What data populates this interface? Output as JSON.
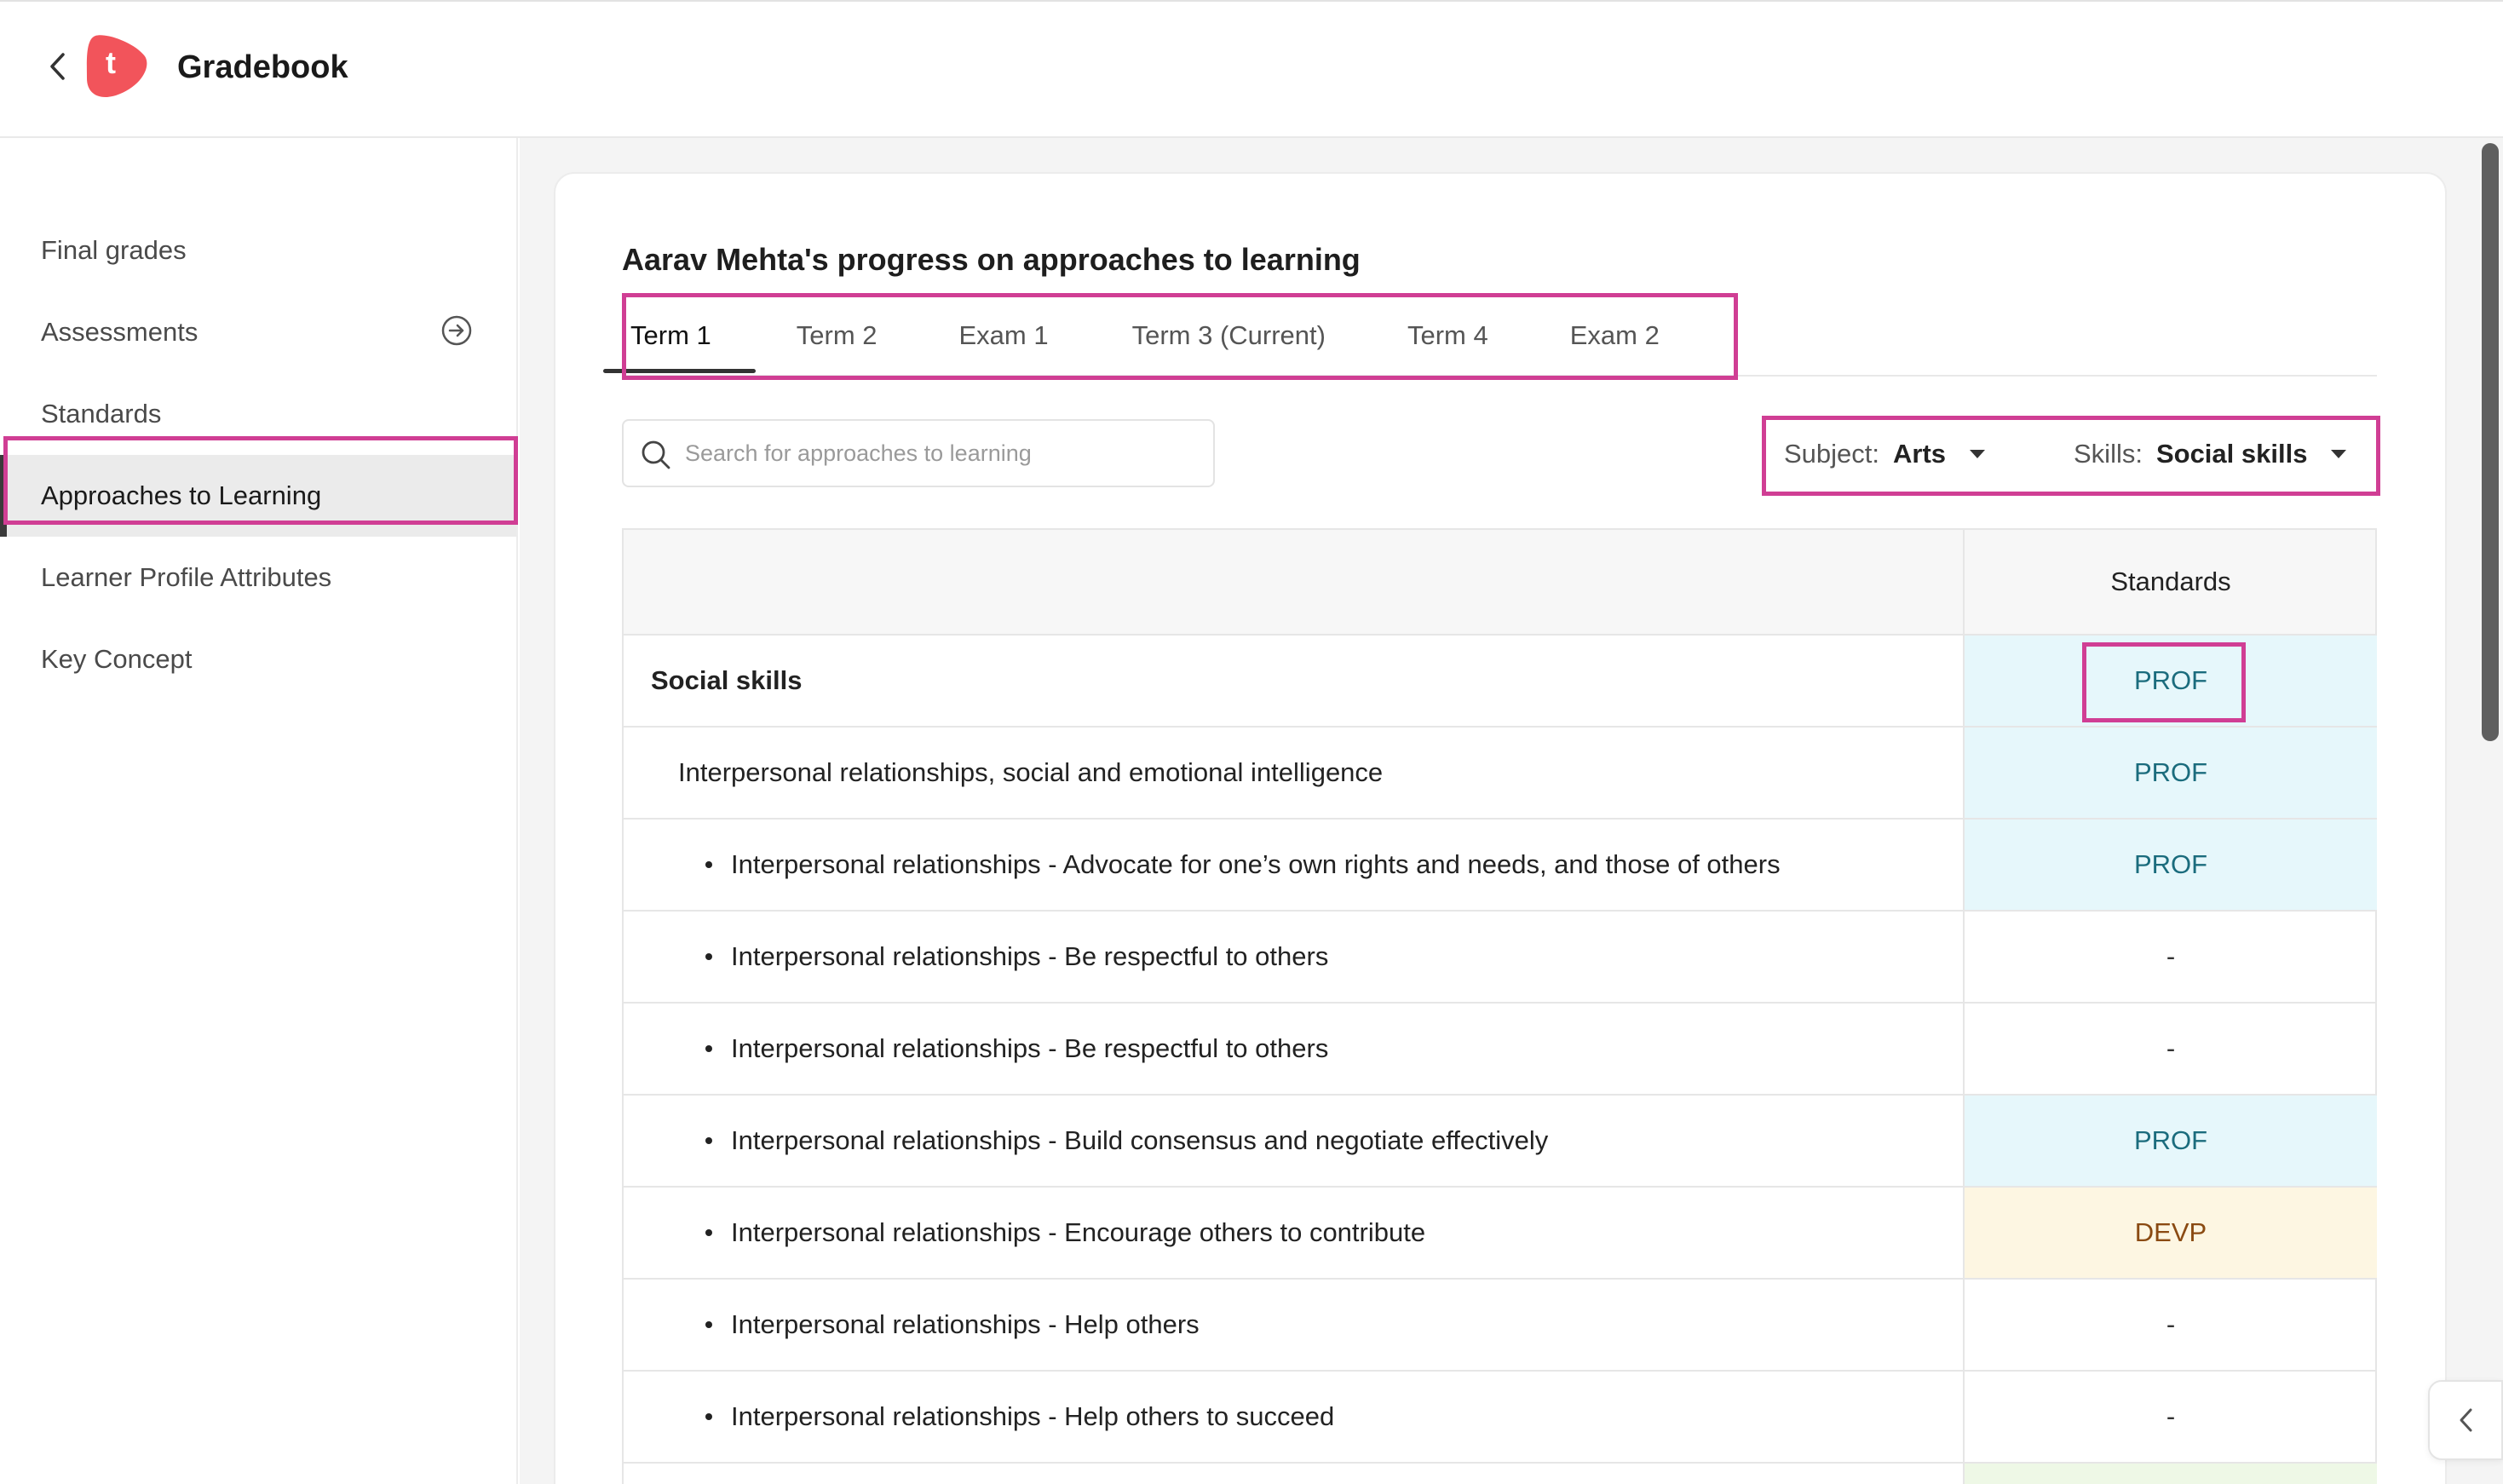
{
  "header": {
    "title": "Gradebook",
    "logo_letter": "t"
  },
  "sidebar": {
    "items": [
      {
        "label": "Final grades"
      },
      {
        "label": "Assessments"
      },
      {
        "label": "Standards"
      },
      {
        "label": "Approaches to Learning"
      },
      {
        "label": "Learner Profile Attributes"
      },
      {
        "label": "Key Concept"
      }
    ],
    "active": "Approaches to Learning"
  },
  "main": {
    "title": "Aarav Mehta's progress on approaches to learning",
    "tabs": [
      {
        "label": "Term 1"
      },
      {
        "label": "Term 2"
      },
      {
        "label": "Exam 1"
      },
      {
        "label": "Term 3 (Current)"
      },
      {
        "label": "Term 4"
      },
      {
        "label": "Exam 2"
      }
    ],
    "active_tab": "Term 1",
    "search": {
      "placeholder": "Search for approaches to learning"
    },
    "filters": {
      "subject_label": "Subject:",
      "subject_value": "Arts",
      "skills_label": "Skills:",
      "skills_value": "Social skills"
    },
    "table": {
      "header_standards": "Standards",
      "rows": [
        {
          "name": "Social skills",
          "value": "PROF"
        },
        {
          "name": "Interpersonal relationships, social and emotional intelligence",
          "value": "PROF"
        },
        {
          "name": "Interpersonal relationships - Advocate for one’s own rights and needs, and those of others",
          "value": "PROF"
        },
        {
          "name": "Interpersonal relationships - Be respectful to others",
          "value": "-"
        },
        {
          "name": "Interpersonal relationships - Be respectful to others",
          "value": "-"
        },
        {
          "name": "Interpersonal relationships - Build consensus and negotiate effectively",
          "value": "PROF"
        },
        {
          "name": "Interpersonal relationships - Encourage others to contribute",
          "value": "DEVP"
        },
        {
          "name": "Interpersonal relationships - Help others",
          "value": "-"
        },
        {
          "name": "Interpersonal relationships - Help others to succeed",
          "value": "-"
        }
      ]
    }
  },
  "colors": {
    "highlight": "#d03e94",
    "logo": "#f2545b",
    "prof_bg": "#e6f7fb",
    "devp_bg": "#fdf6e2"
  }
}
